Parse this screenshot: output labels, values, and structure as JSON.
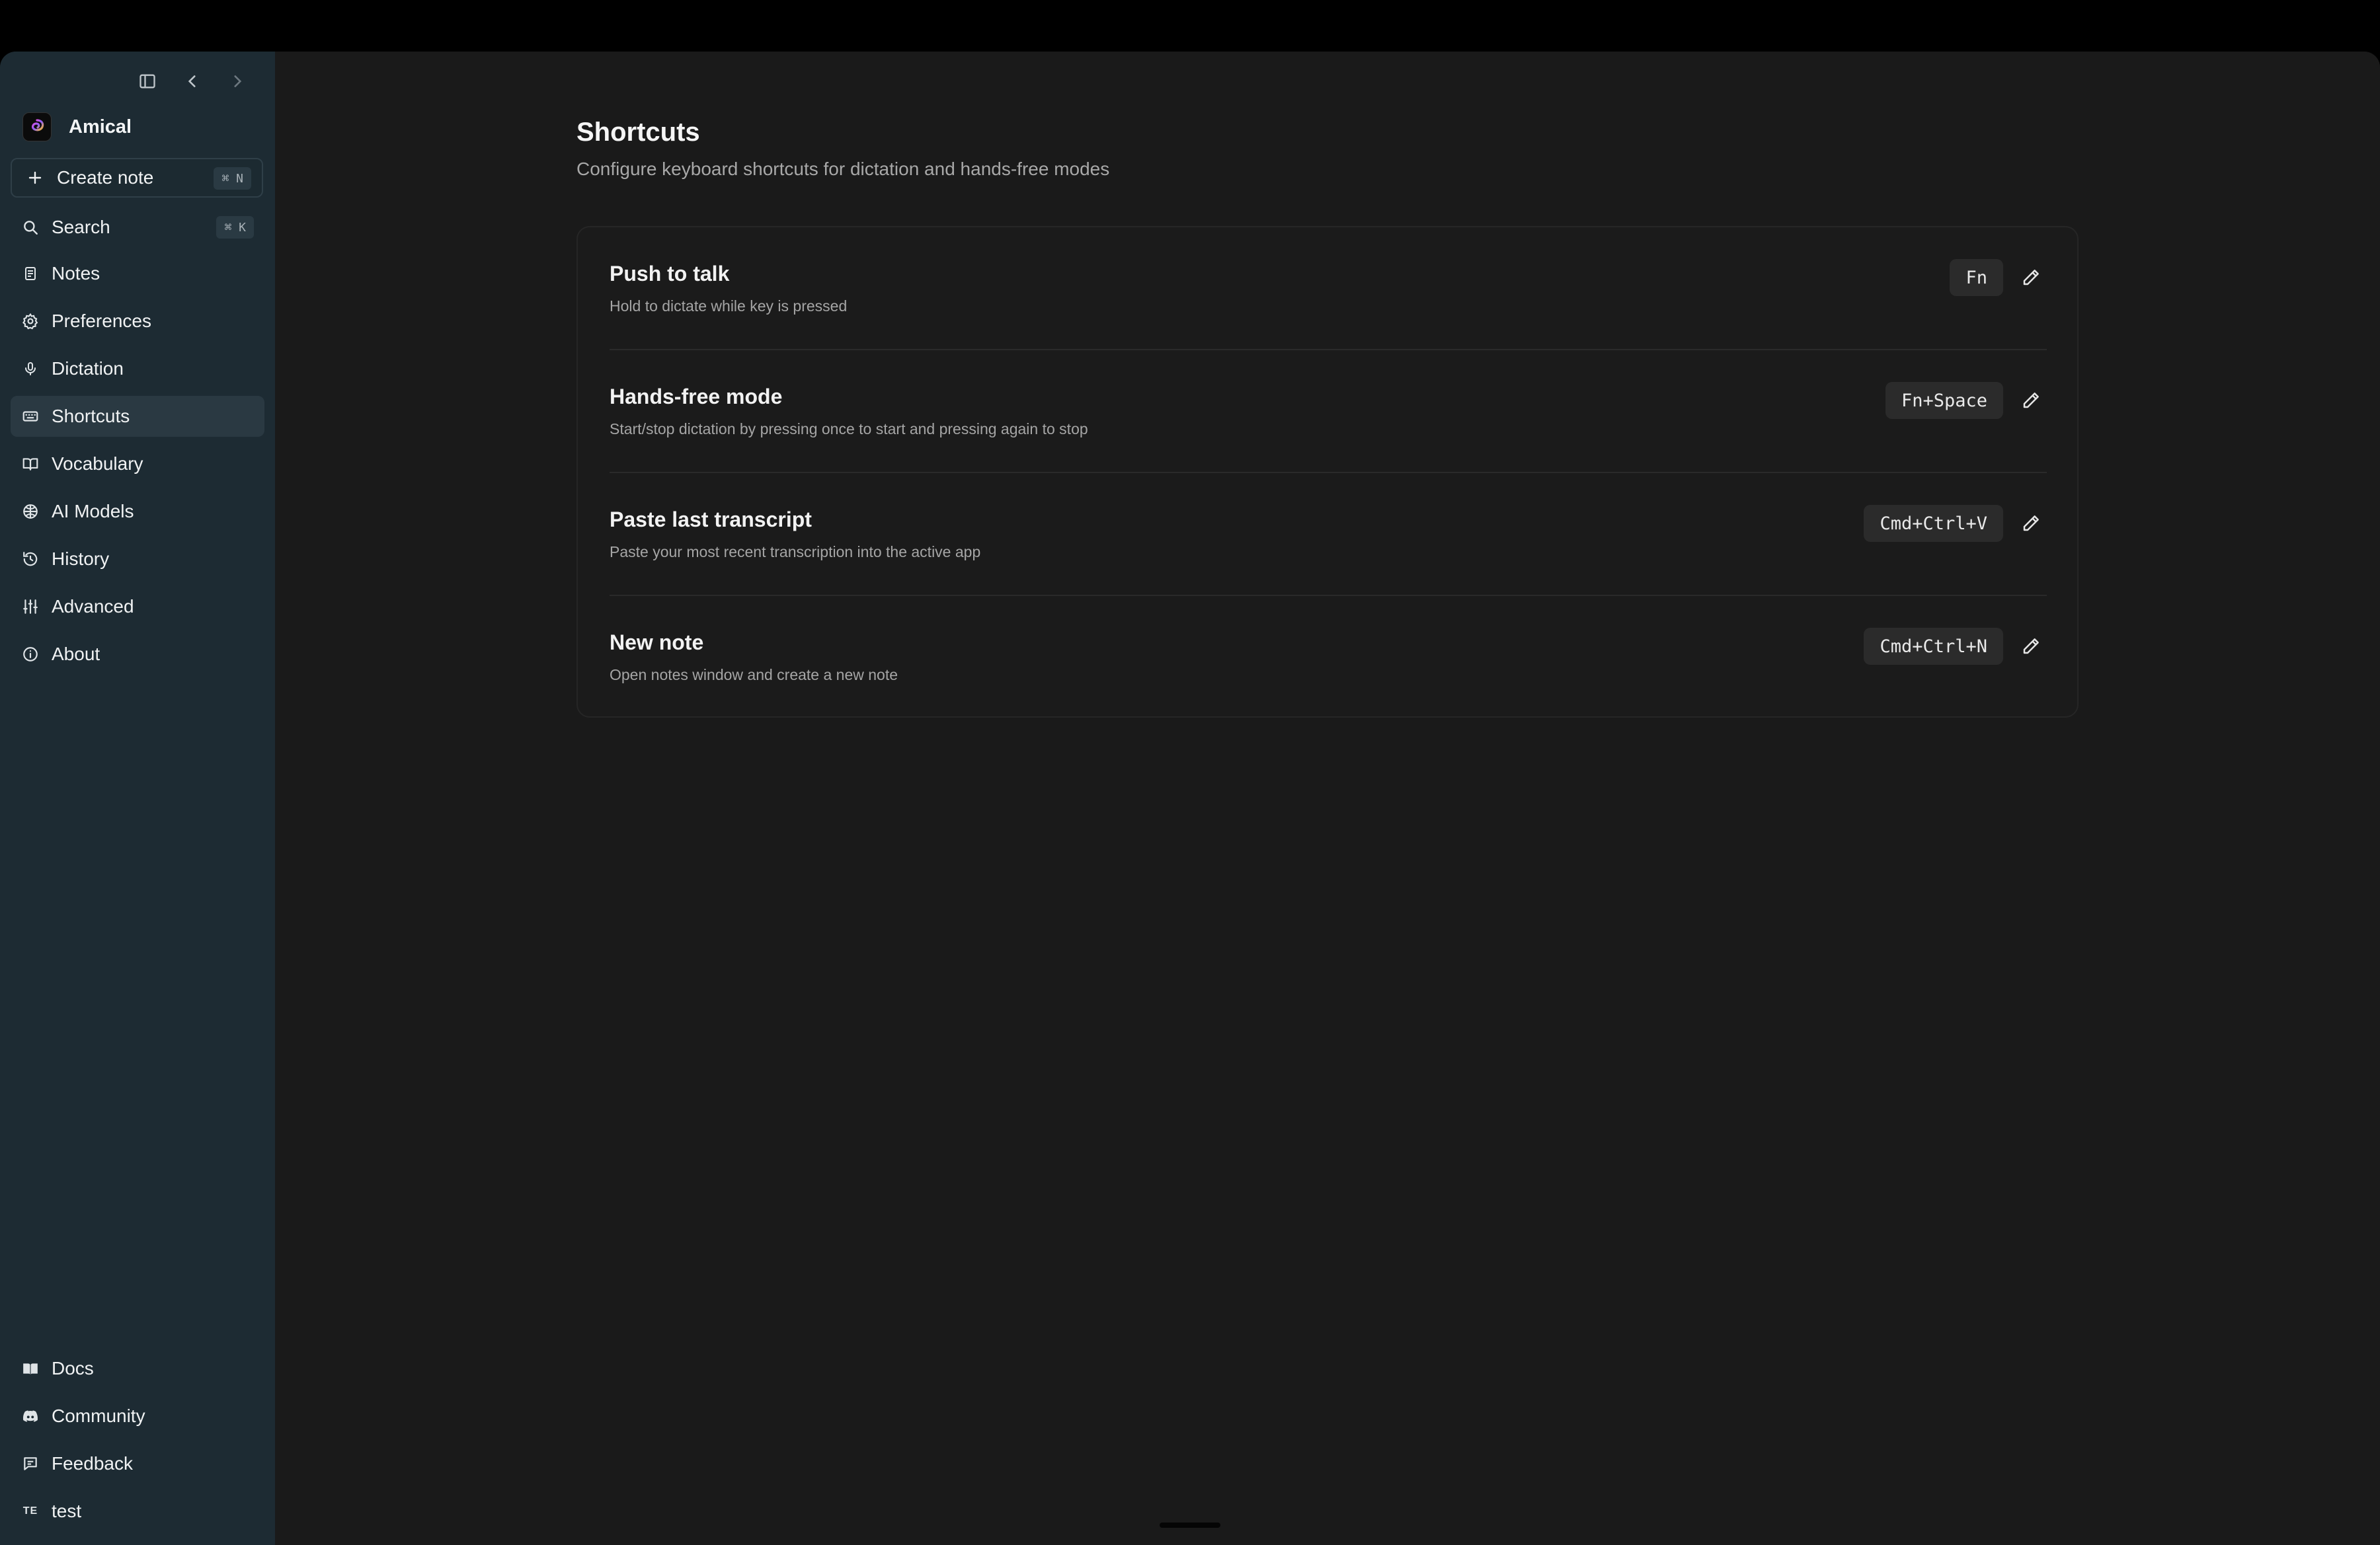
{
  "app": {
    "name": "Amical"
  },
  "sidebar": {
    "create_note": {
      "label": "Create note",
      "shortcut": "⌘ N"
    },
    "search": {
      "label": "Search",
      "shortcut": "⌘ K"
    },
    "items": [
      {
        "label": "Notes",
        "icon": "notes-icon"
      },
      {
        "label": "Preferences",
        "icon": "gear-icon"
      },
      {
        "label": "Dictation",
        "icon": "microphone-icon"
      },
      {
        "label": "Shortcuts",
        "icon": "keyboard-icon",
        "active": true
      },
      {
        "label": "Vocabulary",
        "icon": "book-icon"
      },
      {
        "label": "AI Models",
        "icon": "brain-icon"
      },
      {
        "label": "History",
        "icon": "history-icon"
      },
      {
        "label": "Advanced",
        "icon": "sliders-icon"
      },
      {
        "label": "About",
        "icon": "info-icon"
      }
    ],
    "bottom_items": [
      {
        "label": "Docs",
        "icon": "book-open-icon"
      },
      {
        "label": "Community",
        "icon": "discord-icon"
      },
      {
        "label": "Feedback",
        "icon": "message-icon"
      },
      {
        "label": "test",
        "icon": "avatar",
        "avatar_text": "TE"
      }
    ]
  },
  "main": {
    "title": "Shortcuts",
    "subtitle": "Configure keyboard shortcuts for dictation and hands-free modes",
    "shortcuts": [
      {
        "title": "Push to talk",
        "description": "Hold to dictate while key is pressed",
        "keys": "Fn"
      },
      {
        "title": "Hands-free mode",
        "description": "Start/stop dictation by pressing once to start and pressing again to stop",
        "keys": "Fn+Space"
      },
      {
        "title": "Paste last transcript",
        "description": "Paste your most recent transcription into the active app",
        "keys": "Cmd+Ctrl+V"
      },
      {
        "title": "New note",
        "description": "Open notes window and create a new note",
        "keys": "Cmd+Ctrl+N"
      }
    ]
  },
  "colors": {
    "sidebar_bg": "#1d2b33",
    "main_bg": "#1a1a1a",
    "active_item_bg": "#2a3942"
  }
}
